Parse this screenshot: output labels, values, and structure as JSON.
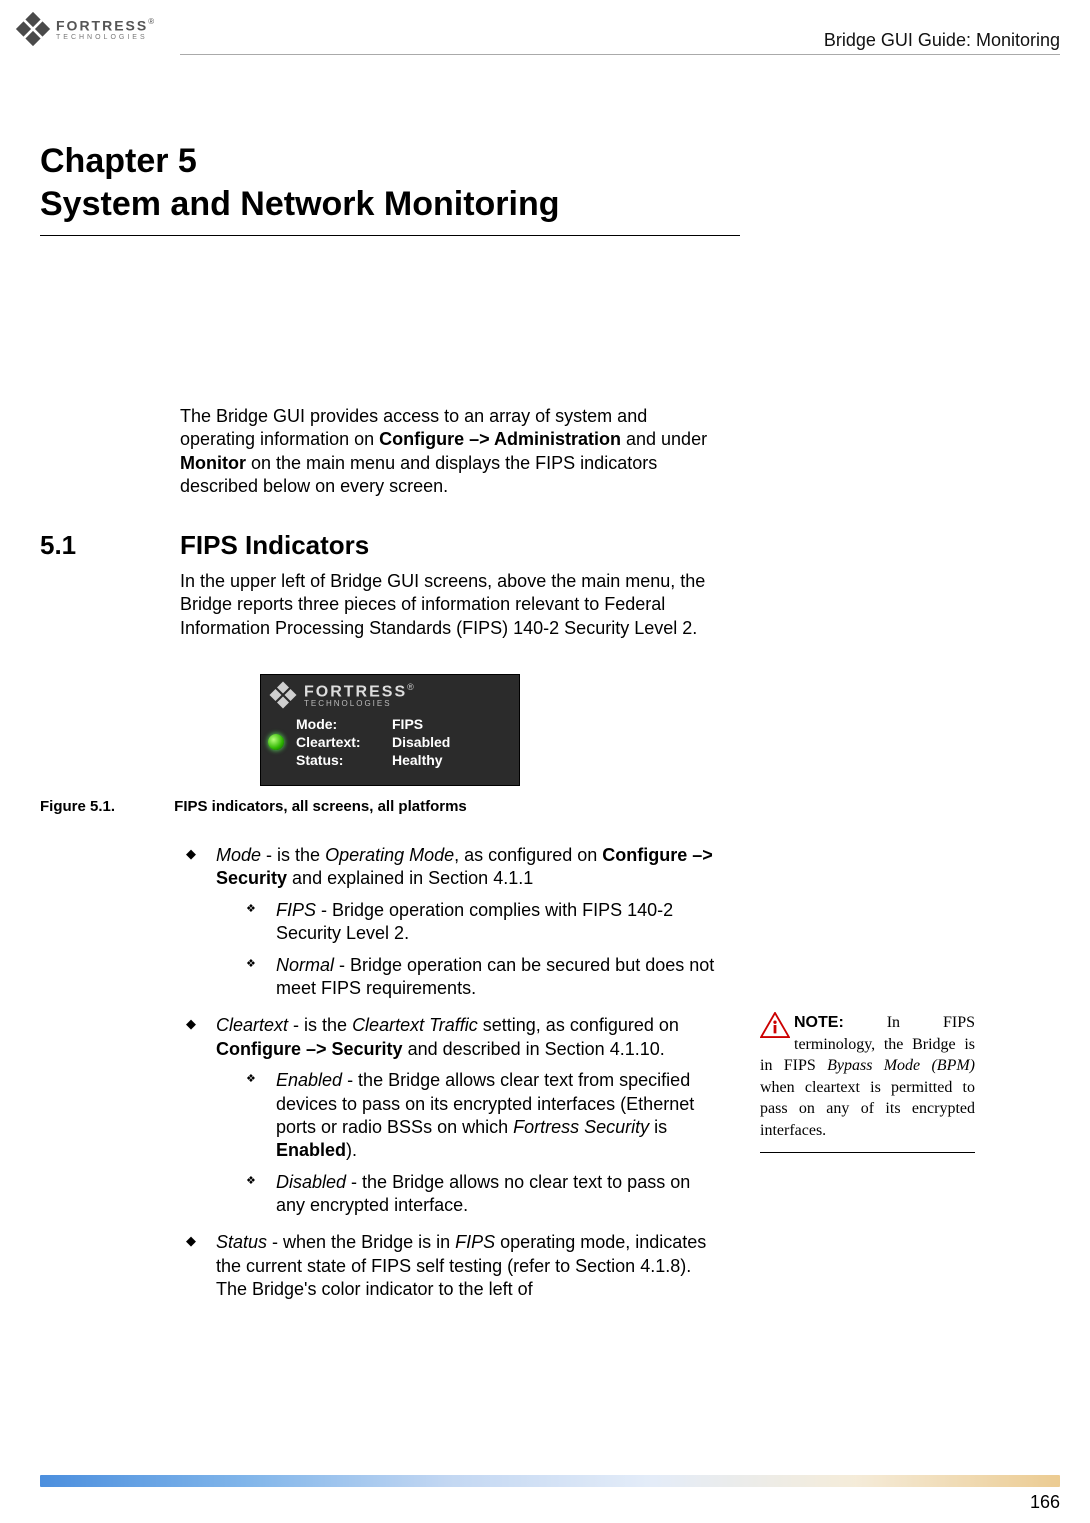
{
  "header": {
    "logo_brand": "FORTRESS",
    "logo_sub": "TECHNOLOGIES",
    "doc_title": "Bridge GUI Guide: Monitoring"
  },
  "chapter": {
    "line1": "Chapter 5",
    "line2": "System and Network Monitoring"
  },
  "intro": {
    "pre": "The Bridge GUI provides access to an array of system and operating information on ",
    "cfg": "Configure",
    "arrow": " –> ",
    "admin": "Administration",
    "mid": " and under ",
    "monitor": "Monitor",
    "post": " on the main menu and displays the FIPS indicators described below on every screen."
  },
  "section": {
    "num": "5.1",
    "title": "FIPS Indicators",
    "para": "In the upper left of Bridge GUI screens, above the main menu, the Bridge reports three pieces of information relevant to Federal Information Processing Standards (FIPS) 140-2 Security Level 2."
  },
  "figure": {
    "num": "Figure 5.1.",
    "caption": "FIPS indicators, all screens, all platforms",
    "shot": {
      "brand": "FORTRESS",
      "sub": "TECHNOLOGIES",
      "rows": [
        {
          "label": "Mode:",
          "value": "FIPS"
        },
        {
          "label": "Cleartext:",
          "value": "Disabled"
        },
        {
          "label": "Status:",
          "value": "Healthy"
        }
      ]
    }
  },
  "bullets": {
    "mode": {
      "term": "Mode",
      "txt1": " - is the ",
      "term2": "Operating Mode",
      "txt2": ", as configured on ",
      "cfg": "Configure –> Security",
      "txt3": " and explained in Section 4.1.1",
      "sub": [
        {
          "term": "FIPS",
          "txt": " - Bridge operation complies with FIPS 140-2 Security Level 2."
        },
        {
          "term": "Normal",
          "txt": " - Bridge operation can be secured but does not meet FIPS requirements."
        }
      ]
    },
    "cleartext": {
      "term": "Cleartext",
      "txt1": " - is the ",
      "term2": "Cleartext Traffic",
      "txt2": " setting, as configured on ",
      "cfg": "Configure –> Security",
      "txt3": " and described in Section 4.1.10.",
      "sub": [
        {
          "term": "Enabled",
          "txt1": " - the Bridge allows clear text from specified devices to pass on its encrypted interfaces (Ethernet ports or radio BSSs on which ",
          "term2": "Fortress Security",
          "txt2": " is ",
          "bold": "Enabled",
          "txt3": ")."
        },
        {
          "term": "Disabled",
          "txt": " - the Bridge allows no clear text to pass on any encrypted interface."
        }
      ]
    },
    "status": {
      "term": "Status",
      "txt1": " - when the Bridge is in ",
      "term2": "FIPS",
      "txt2": " operating mode, indicates the current state of FIPS self testing (refer to Section 4.1.8). The Bridge's color indicator to the left of"
    }
  },
  "sidenote": {
    "label": "NOTE:",
    "txt1": " In FIPS terminology, the Bridge is in FIPS ",
    "ital": "Bypass Mode (BPM)",
    "txt2": " when cleartext is permitted to pass on any of its encrypted interfaces."
  },
  "page_number": "166"
}
